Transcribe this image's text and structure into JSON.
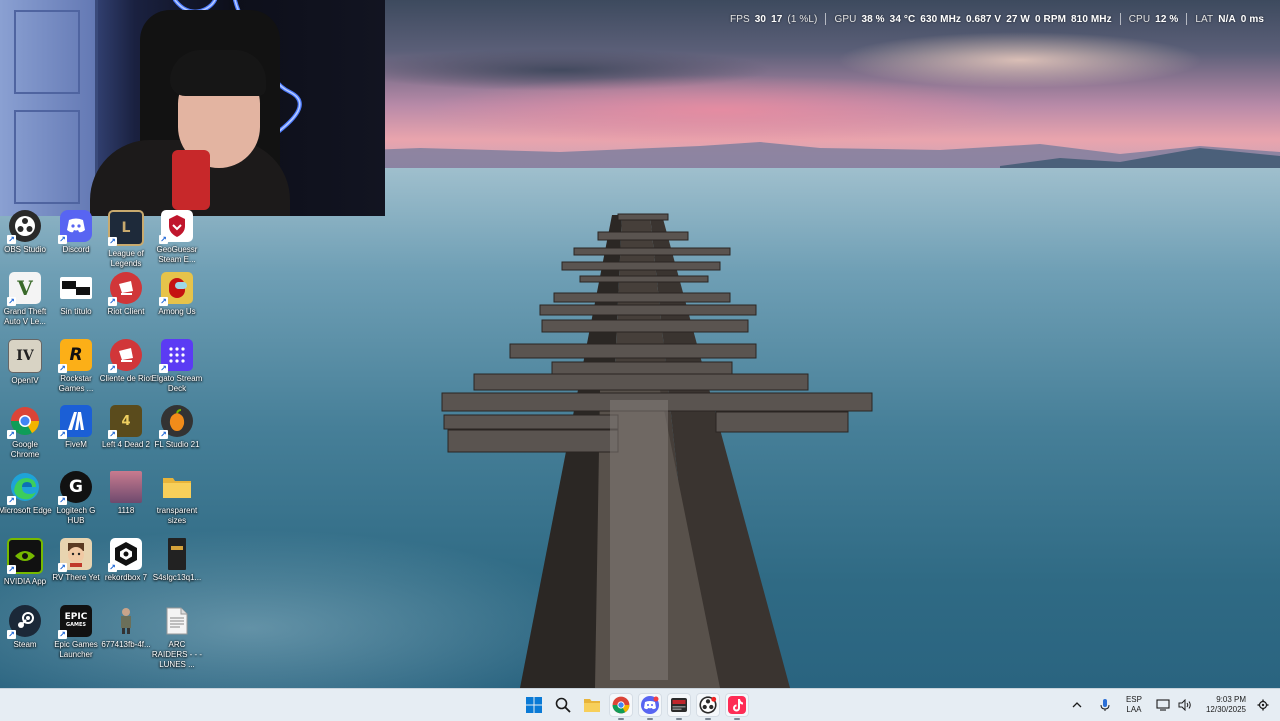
{
  "stats": {
    "fps_label": "FPS",
    "fps_value": "30",
    "fps_low": "17",
    "fps_low_pct": "(1 %L)",
    "gpu_label": "GPU",
    "gpu_usage": "38 %",
    "gpu_temp": "34 °C",
    "gpu_clock": "630 MHz",
    "gpu_voltage": "0.687 V",
    "gpu_power": "27 W",
    "gpu_fan": "0 RPM",
    "gpu_mem_clock": "810 MHz",
    "cpu_label": "CPU",
    "cpu_usage": "12 %",
    "lat_label": "LAT",
    "lat_value": "N/A",
    "lat_ms": "0 ms"
  },
  "desktop_icons": [
    {
      "id": "obs",
      "label": "OBS Studio",
      "icon": "obs-icon",
      "color": "#2a2a2a"
    },
    {
      "id": "discord",
      "label": "Discord",
      "icon": "discord-icon",
      "color": "#5865f2"
    },
    {
      "id": "lol",
      "label": "League of Legends",
      "icon": "league-icon",
      "color": "#1e2a3a"
    },
    {
      "id": "geoguessr",
      "label": "GeoGuessr Steam E...",
      "icon": "geoguessr-icon",
      "color": "#c0162c"
    },
    {
      "id": "gta",
      "label": "Grand Theft Auto V Le...",
      "icon": "gta-icon",
      "color": "#f4f4f4"
    },
    {
      "id": "sintitulo",
      "label": "Sin título",
      "icon": "image-file-icon",
      "color": "#ffffff"
    },
    {
      "id": "riotclient",
      "label": "Riot Client",
      "icon": "riot-icon",
      "color": "#d13639"
    },
    {
      "id": "amongus",
      "label": "Among Us",
      "icon": "among-us-icon",
      "color": "#c51111"
    },
    {
      "id": "openiv",
      "label": "OpenIV",
      "icon": "openiv-icon",
      "color": "#d8d3c4"
    },
    {
      "id": "rockstar",
      "label": "Rockstar Games ...",
      "icon": "rockstar-icon",
      "color": "#fcaf17"
    },
    {
      "id": "clienteriot",
      "label": "Cliente de Riot",
      "icon": "riot-icon",
      "color": "#d13639"
    },
    {
      "id": "streamdeck",
      "label": "Elgato Stream Deck",
      "icon": "stream-deck-icon",
      "color": "#5b3bf4"
    },
    {
      "id": "chrome",
      "label": "Google Chrome",
      "icon": "chrome-icon",
      "color": "#ffffff"
    },
    {
      "id": "fivem",
      "label": "FiveM",
      "icon": "fivem-icon",
      "color": "#1b5fd6"
    },
    {
      "id": "l4d2",
      "label": "Left 4 Dead 2",
      "icon": "left4dead-icon",
      "color": "#5a4b1c"
    },
    {
      "id": "flstudio",
      "label": "FL Studio 21",
      "icon": "fl-studio-icon",
      "color": "#f28c1a"
    },
    {
      "id": "edge",
      "label": "Microsoft Edge",
      "icon": "edge-icon",
      "color": "#1fa3d8"
    },
    {
      "id": "logitech",
      "label": "Logitech G HUB",
      "icon": "logitech-icon",
      "color": "#111111"
    },
    {
      "id": "img1118",
      "label": "1118",
      "icon": "image-file-icon",
      "color": "#b0657a"
    },
    {
      "id": "transparent",
      "label": "transparent sizes",
      "icon": "folder-icon",
      "color": "#f5c84a"
    },
    {
      "id": "nvidia",
      "label": "NVIDIA App",
      "icon": "nvidia-icon",
      "color": "#76b900"
    },
    {
      "id": "rvthereyet",
      "label": "RV There Yet",
      "icon": "rv-there-yet-icon",
      "color": "#e8d4b0"
    },
    {
      "id": "rekordbox",
      "label": "rekordbox 7",
      "icon": "rekordbox-icon",
      "color": "#111111"
    },
    {
      "id": "s4s",
      "label": "S4slgc13q1...",
      "icon": "image-file-icon",
      "color": "#222222"
    },
    {
      "id": "steam",
      "label": "Steam",
      "icon": "steam-icon",
      "color": "#1b2838"
    },
    {
      "id": "epic",
      "label": "Epic Games Launcher",
      "icon": "epic-games-icon",
      "color": "#111111"
    },
    {
      "id": "img677",
      "label": "677413fb-4f...",
      "icon": "image-file-icon",
      "color": "#d7d7d7"
    },
    {
      "id": "arcraiders",
      "label": "ARC RAIDERS - - - LUNES ...",
      "icon": "text-file-icon",
      "color": "#f4f4f4"
    }
  ],
  "taskbar": {
    "apps": [
      {
        "name": "start-button",
        "icon": "windows-icon"
      },
      {
        "name": "search-button",
        "icon": "search-icon"
      },
      {
        "name": "file-explorer-button",
        "icon": "folder-icon"
      },
      {
        "name": "chrome-button",
        "icon": "chrome-icon"
      },
      {
        "name": "discord-button",
        "icon": "discord-icon"
      },
      {
        "name": "video-editor-button",
        "icon": "video-editor-icon"
      },
      {
        "name": "obs-button",
        "icon": "obs-icon"
      },
      {
        "name": "tiktok-button",
        "icon": "tiktok-icon"
      }
    ],
    "lang_top": "ESP",
    "lang_bottom": "LAA",
    "time": "9:03 PM",
    "date": "12/30/2025"
  },
  "colors": {
    "taskbar_bg": "#e6edf3",
    "overlay_text": "#ffffff"
  }
}
